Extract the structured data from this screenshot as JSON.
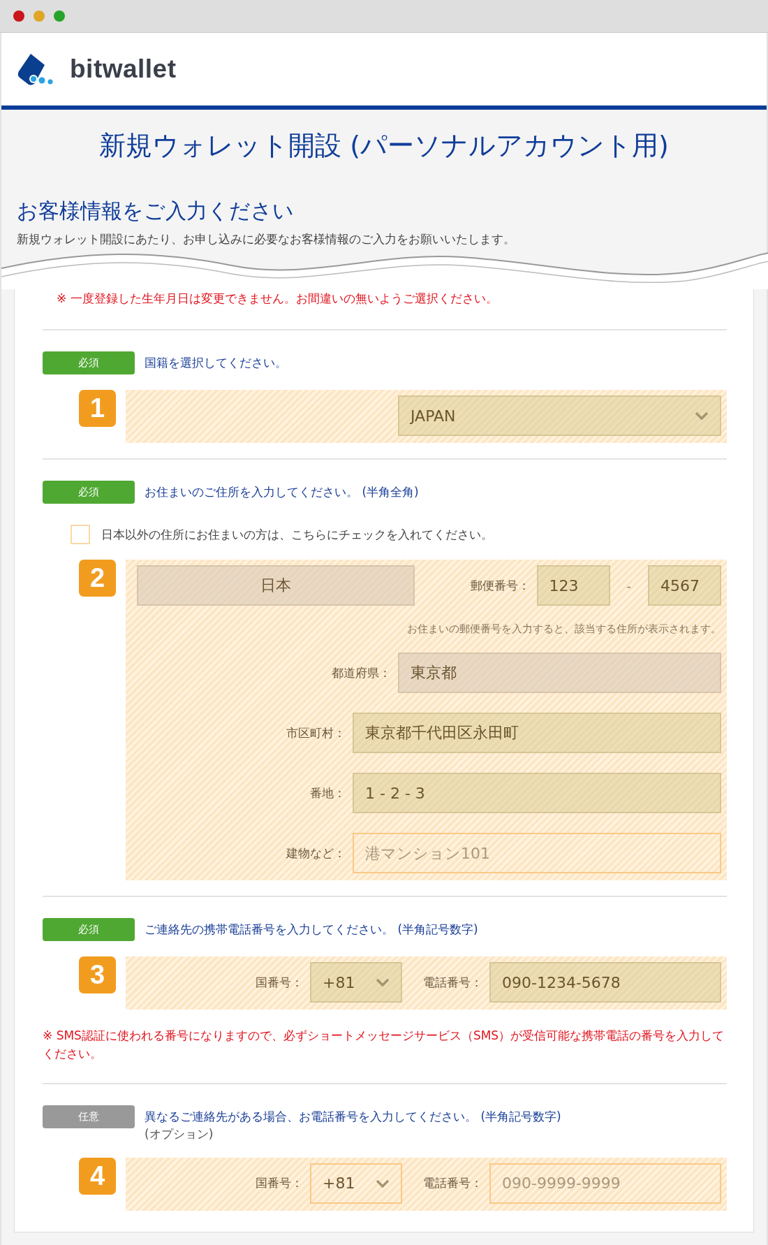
{
  "browser": {
    "buttons": [
      {
        "color": "#c8161b"
      },
      {
        "color": "#e0a526"
      },
      {
        "color": "#27a32a"
      }
    ]
  },
  "header": {
    "logo_text": "bitwallet"
  },
  "page_title": "新規ウォレット開設 (パーソナルアカウント用)",
  "section": {
    "heading": "お客様情報をご入力ください",
    "description": "新規ウォレット開設にあたり、お申し込みに必要なお客様情報のご入力をお願いいたします。"
  },
  "notice": "※ 一度登録した生年月日は変更できません。お間違いの無いようご選択ください。",
  "steps": [
    {
      "badge": {
        "text": "必須",
        "kind": "required"
      },
      "instruction": "国籍を選択してください。",
      "number": "1",
      "rows": [
        {
          "items": [
            {
              "kind": "select",
              "value": "JAPAN",
              "filled": true,
              "readonly": false
            }
          ]
        }
      ]
    },
    {
      "badge": {
        "text": "必須",
        "kind": "required"
      },
      "instruction": "お住まいのご住所を入力してください。 (半角全角)",
      "checkbox": {
        "label": "日本以外の住所にお住まいの方は、こちらにチェックを入れてください。",
        "checked": false
      },
      "number": "2",
      "rows": [
        {
          "items": [
            {
              "kind": "country",
              "value": "日本",
              "readonly": true
            },
            {
              "kind": "label",
              "text": "郵便番号："
            },
            {
              "kind": "short",
              "value": "123",
              "filled": true,
              "readonly": false
            },
            {
              "kind": "separator",
              "text": "-"
            },
            {
              "kind": "short",
              "value": "4567",
              "filled": true,
              "readonly": false
            }
          ]
        },
        {
          "items": [
            {
              "kind": "hint",
              "text": "お住まいの郵便番号を入力すると、該当する住所が表示されます。"
            }
          ]
        },
        {
          "items": [
            {
              "kind": "label",
              "text": "都道府県："
            },
            {
              "kind": "text-medium",
              "value": "東京都",
              "readonly": true
            }
          ]
        },
        {
          "items": [
            {
              "kind": "label",
              "text": "市区町村："
            },
            {
              "kind": "text",
              "value": "東京都千代田区永田町",
              "filled": true,
              "readonly": false
            }
          ]
        },
        {
          "items": [
            {
              "kind": "label",
              "text": "番地："
            },
            {
              "kind": "text",
              "value": "1 - 2 - 3",
              "filled": true,
              "readonly": false
            }
          ]
        },
        {
          "items": [
            {
              "kind": "label",
              "text": "建物など："
            },
            {
              "kind": "text",
              "placeholder": "港マンション101",
              "filled": false,
              "readonly": false
            }
          ]
        }
      ]
    },
    {
      "badge": {
        "text": "必須",
        "kind": "required"
      },
      "instruction": "ご連絡先の携帯電話番号を入力してください。 (半角記号数字)",
      "number": "3",
      "rows": [
        {
          "items": [
            {
              "kind": "label",
              "text": "国番号："
            },
            {
              "kind": "code-select",
              "value": "+81",
              "filled": true,
              "readonly": false
            },
            {
              "kind": "label",
              "text": "電話番号："
            },
            {
              "kind": "phone",
              "value": "090-1234-5678",
              "filled": true,
              "readonly": false
            }
          ]
        }
      ],
      "note": "※ SMS認証に使われる番号になりますので、必ずショートメッセージサービス（SMS）が受信可能な携帯電話の番号を入力してください。"
    },
    {
      "badge": {
        "text": "任意",
        "kind": "optional"
      },
      "instruction": "異なるご連絡先がある場合、お電話番号を入力してください。 (半角記号数字)",
      "instruction_note": "(オプション)",
      "number": "4",
      "rows": [
        {
          "items": [
            {
              "kind": "label",
              "text": "国番号："
            },
            {
              "kind": "code-select",
              "value": "+81",
              "filled": false,
              "readonly": false
            },
            {
              "kind": "label",
              "text": "電話番号："
            },
            {
              "kind": "phone",
              "placeholder": "090-9999-9999",
              "filled": false,
              "readonly": false
            }
          ]
        }
      ]
    }
  ]
}
